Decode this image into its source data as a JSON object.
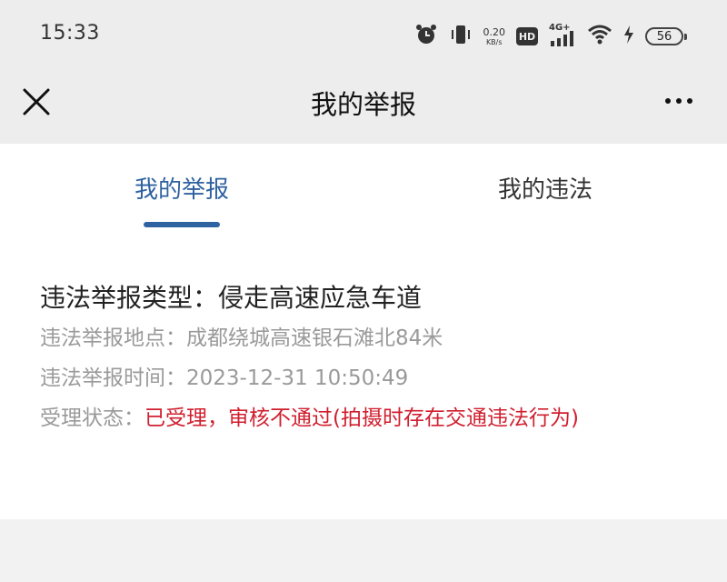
{
  "status_bar": {
    "time": "15:33",
    "net_speed_value": "0.20",
    "net_speed_unit": "KB/s",
    "hd_label": "HD",
    "signal_label": "4G+",
    "battery_level": "56",
    "icons": [
      "alarm-icon",
      "vibrate-icon",
      "network-speed-icon",
      "hd-icon",
      "signal-4g-icon",
      "wifi-icon",
      "charging-icon",
      "battery-icon"
    ]
  },
  "nav": {
    "title": "我的举报",
    "close_icon": "close-icon",
    "more_icon": "more-icon"
  },
  "tabs": [
    {
      "label": "我的举报",
      "active": true
    },
    {
      "label": "我的违法",
      "active": false
    }
  ],
  "report": {
    "type_label": "违法举报类型：",
    "type_value": "侵走高速应急车道",
    "location_label": "违法举报地点：",
    "location_value": "成都绕城高速银石滩北84米",
    "time_label": "违法举报时间：",
    "time_value": "2023-12-31 10:50:49",
    "status_label": "受理状态：",
    "status_value": "已受理，审核不通过(拍摄时存在交通违法行为)"
  },
  "colors": {
    "accent": "#2f62a0",
    "status_red": "#d01f2f",
    "muted_text": "#9a9a9a",
    "header_bg": "#ededed"
  }
}
